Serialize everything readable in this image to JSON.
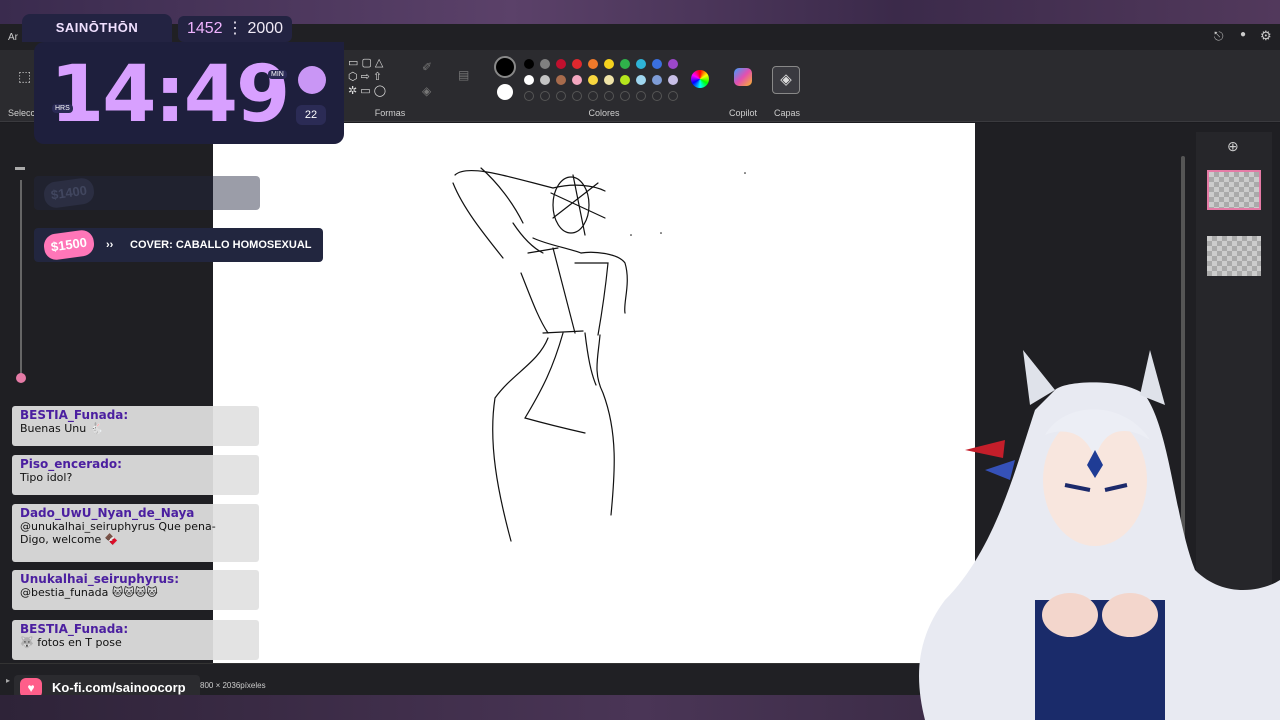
{
  "app": {
    "title_fragment": "Ar",
    "select_label_fragment": "Selecci"
  },
  "ribbon": {
    "shapes_label": "Formas",
    "colors_label": "Colores",
    "copilot_label": "Copilot",
    "layers_label": "Capas",
    "swatches_row1": [
      "#000000",
      "#808080",
      "#c0102e",
      "#e0282e",
      "#f07a2a",
      "#f5d21e",
      "#2fb34a",
      "#2eb3d7",
      "#3a6fe0",
      "#9b47c9"
    ],
    "swatches_row2": [
      "#ffffff",
      "#c3c3c3",
      "#a86b4c",
      "#f4a7c0",
      "#f8d63f",
      "#efe4a8",
      "#b5e61d",
      "#9fd6ef",
      "#7e9cd6",
      "#c8bfe7"
    ]
  },
  "overlay": {
    "stream_name": "SAINŌTHŌN",
    "goal_current": "1452",
    "goal_separator": "⋮",
    "goal_total": "2000",
    "clock_time": "14:49",
    "clock_hrs": "HRS",
    "clock_min": "MIN",
    "clock_sec": "22",
    "goal_faded_badge": "$1400",
    "goal_badge": "$1500",
    "goal_arrow": "››",
    "goal_text": "COVER: CABALLO HOMOSEXUAL"
  },
  "chat": [
    {
      "user": "BESTIA_Funada:",
      "text": "Buenas Unu 🐇",
      "user_color": "#4b1fa0"
    },
    {
      "user": "Piso_encerado:",
      "text": "Tipo idol?",
      "user_color": "#4b1fa0"
    },
    {
      "user": "Dado_UwU_Nyan_de_Naya",
      "text": "@unukalhai_seiruphyrus Que pena-",
      "text2": "Digo, welcome 🍫",
      "user_color": "#4b1fa0"
    },
    {
      "user": "Unukalhai_seiruphyrus:",
      "text": "@bestia_funada 🐱🐱🐱🐱",
      "user_color": "#4b1fa0"
    },
    {
      "user": "BESTIA_Funada:",
      "text": "🐺 fotos en T pose",
      "user_color": "#4b1fa0"
    }
  ],
  "status": {
    "kofi": "Ko-fi.com/sainoocorp",
    "canvas_size": "800 × 2036píxeles"
  }
}
